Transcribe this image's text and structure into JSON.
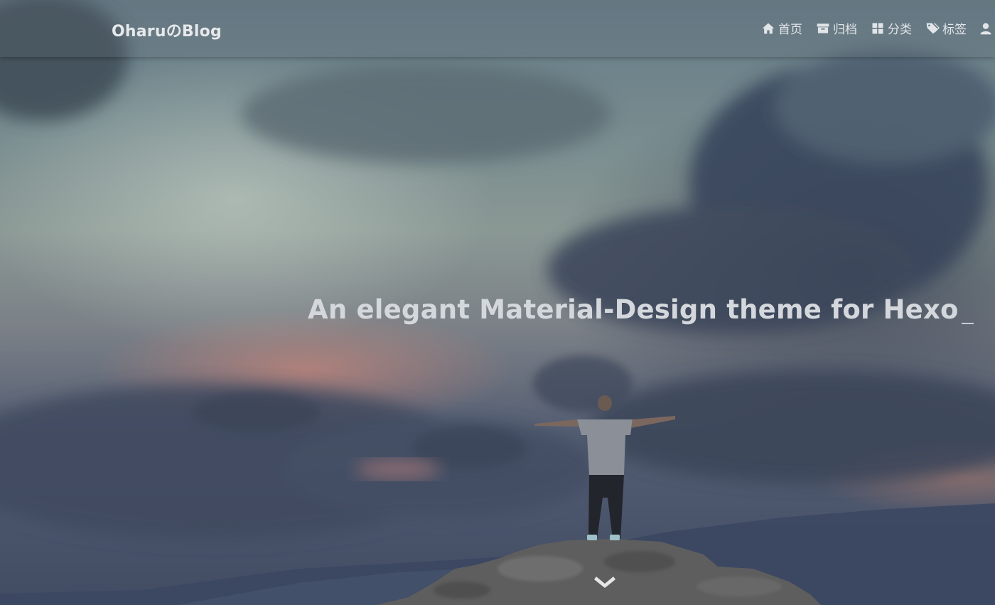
{
  "header": {
    "brand": "OharuのBlog"
  },
  "nav": {
    "items": [
      {
        "label": "首页",
        "icon": "home-icon"
      },
      {
        "label": "归档",
        "icon": "archive-icon"
      },
      {
        "label": "分类",
        "icon": "categories-icon"
      },
      {
        "label": "标签",
        "icon": "tags-icon"
      },
      {
        "label": "",
        "icon": "user-icon"
      }
    ]
  },
  "hero": {
    "headline": "An elegant Material-Design theme for Hexo",
    "scroll_icon": "chevron-down-icon"
  },
  "colors": {
    "nav_text": "#e2e5e8",
    "headline_text": "#d4d8dc"
  }
}
